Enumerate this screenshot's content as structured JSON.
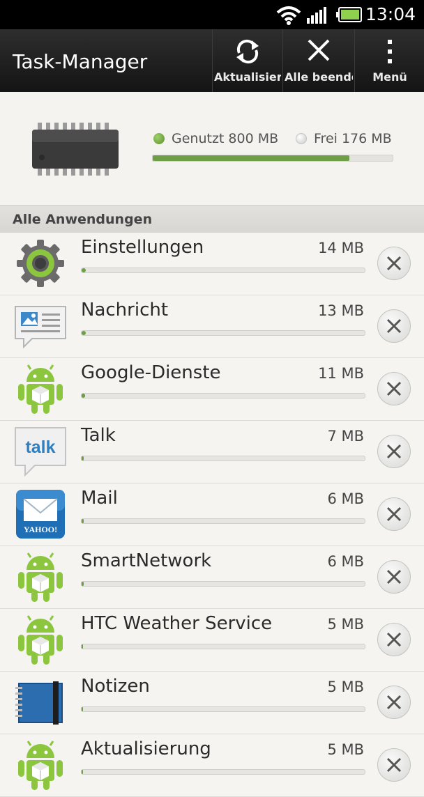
{
  "status": {
    "time": "13:04"
  },
  "header": {
    "title": "Task-Manager",
    "actions": [
      {
        "label": "Aktualisieren",
        "icon": "refresh-icon"
      },
      {
        "label": "Alle beenden",
        "icon": "close-all-icon"
      },
      {
        "label": "Menü",
        "icon": "menu-icon"
      }
    ]
  },
  "memory": {
    "used_label": "Genutzt 800 MB",
    "free_label": "Frei 176 MB",
    "used_mb": 800,
    "free_mb": 176
  },
  "section": {
    "title": "Alle Anwendungen"
  },
  "apps": [
    {
      "name": "Einstellungen",
      "size": "14 MB",
      "mb": 14,
      "icon": "settings-gear-icon"
    },
    {
      "name": "Nachricht",
      "size": "13 MB",
      "mb": 13,
      "icon": "message-icon"
    },
    {
      "name": "Google-Dienste",
      "size": "11 MB",
      "mb": 11,
      "icon": "android-icon"
    },
    {
      "name": "Talk",
      "size": "7 MB",
      "mb": 7,
      "icon": "talk-icon"
    },
    {
      "name": "Mail",
      "size": "6 MB",
      "mb": 6,
      "icon": "yahoo-mail-icon"
    },
    {
      "name": "SmartNetwork",
      "size": "6 MB",
      "mb": 6,
      "icon": "android-icon"
    },
    {
      "name": "HTC Weather Service",
      "size": "5 MB",
      "mb": 5,
      "icon": "android-icon"
    },
    {
      "name": "Notizen",
      "size": "5 MB",
      "mb": 5,
      "icon": "notebook-icon"
    },
    {
      "name": "Aktualisierung",
      "size": "5 MB",
      "mb": 5,
      "icon": "android-icon"
    }
  ],
  "colors": {
    "accent": "#6e9e45",
    "actionbar": "#1c1c1c"
  }
}
